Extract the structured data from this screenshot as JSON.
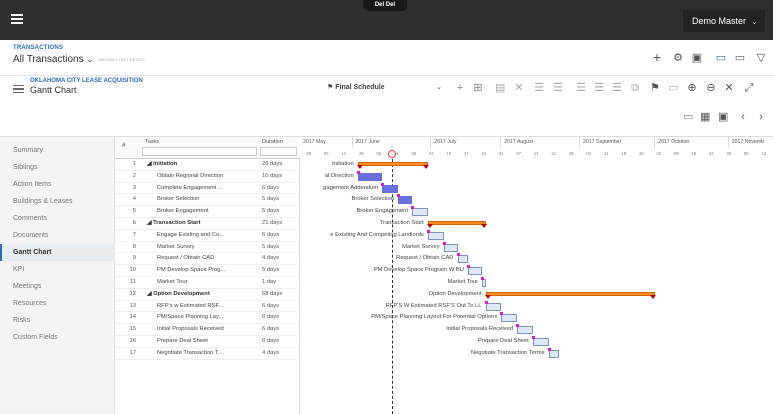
{
  "topbar": {
    "logo": "Del Del",
    "user": "Demo Master"
  },
  "header": {
    "section_label": "TRANSACTIONS",
    "section_title": "All Transactions",
    "section_sub": "SHOWING LAST RESULT"
  },
  "project": {
    "label": "OKLAHOMA CITY LEASE ACQUISITION",
    "title": "Gantt Chart",
    "schedule": "Final Schedule"
  },
  "sidebar": {
    "items": [
      "Summary",
      "Siblings",
      "Action Items",
      "Buildings & Leases",
      "Comments",
      "Documents",
      "Gantt Chart",
      "KPI",
      "Meetings",
      "Resources",
      "Risks",
      "Custom Fields"
    ],
    "active": "Gantt Chart"
  },
  "grid": {
    "col_num": "#",
    "col_task": "Tasks",
    "col_duration": "Duration",
    "rows": [
      {
        "n": "1",
        "task": "Initiation",
        "dur": "26 days",
        "summary": true
      },
      {
        "n": "2",
        "task": "Obtain Regional Direction",
        "dur": "10 days"
      },
      {
        "n": "3",
        "task": "Complete Engagement ...",
        "dur": "6 days"
      },
      {
        "n": "4",
        "task": "Broker Selection",
        "dur": "5 days"
      },
      {
        "n": "5",
        "task": "Broker Engagement",
        "dur": "5 days"
      },
      {
        "n": "6",
        "task": "Transaction Start",
        "dur": "21 days",
        "summary": true
      },
      {
        "n": "7",
        "task": "Engage Existing and Co...",
        "dur": "6 days"
      },
      {
        "n": "8",
        "task": "Market Survey",
        "dur": "5 days"
      },
      {
        "n": "9",
        "task": "Request / Obtain CAD",
        "dur": "4 days"
      },
      {
        "n": "10",
        "task": "PM Develop Space Prog...",
        "dur": "5 days"
      },
      {
        "n": "11",
        "task": "Market Tour",
        "dur": "1 day"
      },
      {
        "n": "12",
        "task": "Option Development",
        "dur": "68 days",
        "summary": true
      },
      {
        "n": "13",
        "task": "RFP's w Estimated RSF...",
        "dur": "6 days"
      },
      {
        "n": "14",
        "task": "PM/Space Planning Lay...",
        "dur": "6 days"
      },
      {
        "n": "15",
        "task": "Initial Proposals Received",
        "dur": "6 days"
      },
      {
        "n": "16",
        "task": "Prepare Deal Sheet",
        "dur": "6 days"
      },
      {
        "n": "17",
        "task": "Negotiate Transaction T...",
        "dur": "4 days"
      }
    ]
  },
  "chart_data": {
    "type": "gantt",
    "months": [
      "2017 May",
      "2017 June",
      "2017 July",
      "2017 August",
      "2017 September",
      "2017 October",
      "2017 Novemb"
    ],
    "week_ticks": [
      "28",
      "05",
      "12",
      "29",
      "05",
      "19",
      "26",
      "03",
      "10",
      "17",
      "24",
      "31",
      "07",
      "14",
      "21",
      "28",
      "04",
      "11",
      "18",
      "25",
      "02",
      "09",
      "16",
      "23",
      "30",
      "06",
      "13"
    ],
    "bars": [
      {
        "label": "Initiation",
        "start_week": 9.3,
        "end_week": 13.3,
        "kind": "summary"
      },
      {
        "label": "al Direction",
        "start_week": 9.3,
        "end_week": 10.7,
        "kind": "task"
      },
      {
        "label": "gagement Addendum",
        "start_week": 10.7,
        "end_week": 11.6,
        "kind": "task"
      },
      {
        "label": "Broker Selection",
        "start_week": 11.6,
        "end_week": 12.4,
        "kind": "task"
      },
      {
        "label": "Broker Engagement",
        "start_week": 12.4,
        "end_week": 13.3,
        "kind": "plan"
      },
      {
        "label": "Transaction Start",
        "start_week": 13.3,
        "end_week": 16.6,
        "kind": "summary"
      },
      {
        "label": "e Existing And Competing Landlords",
        "start_week": 13.3,
        "end_week": 14.2,
        "kind": "plan"
      },
      {
        "label": "Market Survey",
        "start_week": 14.2,
        "end_week": 15.0,
        "kind": "plan"
      },
      {
        "label": "Request / Obtain CAD",
        "start_week": 15.0,
        "end_week": 15.6,
        "kind": "plan"
      },
      {
        "label": "PM Develop Space Program W BU",
        "start_week": 15.6,
        "end_week": 16.4,
        "kind": "plan"
      },
      {
        "label": "Market Tour",
        "start_week": 16.4,
        "end_week": 16.6,
        "kind": "plan"
      },
      {
        "label": "Option Development",
        "start_week": 16.6,
        "end_week": 26.3,
        "kind": "summary"
      },
      {
        "label": "RFP'S W Estimated RSF'S Out To LL",
        "start_week": 16.6,
        "end_week": 17.5,
        "kind": "plan"
      },
      {
        "label": "PM/Space Planning Layout For Potential Options",
        "start_week": 17.5,
        "end_week": 18.4,
        "kind": "plan"
      },
      {
        "label": "Initial Proposals Received",
        "start_week": 18.4,
        "end_week": 19.3,
        "kind": "plan"
      },
      {
        "label": "Prepare Deal Sheet",
        "start_week": 19.3,
        "end_week": 20.2,
        "kind": "plan"
      },
      {
        "label": "Negotiate Transaction Terms",
        "start_week": 20.2,
        "end_week": 20.8,
        "kind": "plan"
      }
    ]
  }
}
